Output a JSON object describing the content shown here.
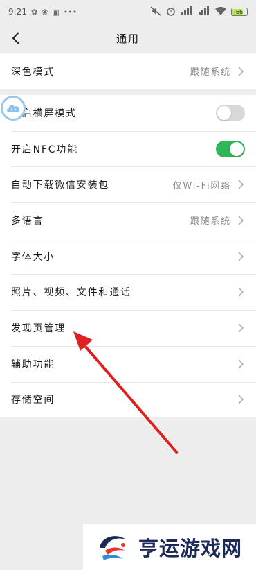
{
  "status_bar": {
    "time": "9:21",
    "battery": "66"
  },
  "nav": {
    "title": "通用"
  },
  "group1": {
    "dark_mode": {
      "label": "深色模式",
      "value": "跟随系统"
    }
  },
  "group2": {
    "landscape": {
      "label": "开启横屏模式",
      "enabled": false
    },
    "nfc": {
      "label": "开启NFC功能",
      "enabled": true
    },
    "auto_download": {
      "label": "自动下载微信安装包",
      "value": "仅Wi-Fi网络"
    },
    "language": {
      "label": "多语言",
      "value": "跟随系统"
    },
    "font_size": {
      "label": "字体大小"
    },
    "media": {
      "label": "照片、视频、文件和通话"
    },
    "discover": {
      "label": "发现页管理"
    },
    "accessibility": {
      "label": "辅助功能"
    },
    "storage": {
      "label": "存储空间"
    }
  },
  "colors": {
    "toggle_on": "#2fb55a",
    "toggle_off": "#d8d8d8",
    "arrow": "#e02020",
    "background": "#ededed"
  },
  "watermark": {
    "text": "亨运游戏网"
  }
}
